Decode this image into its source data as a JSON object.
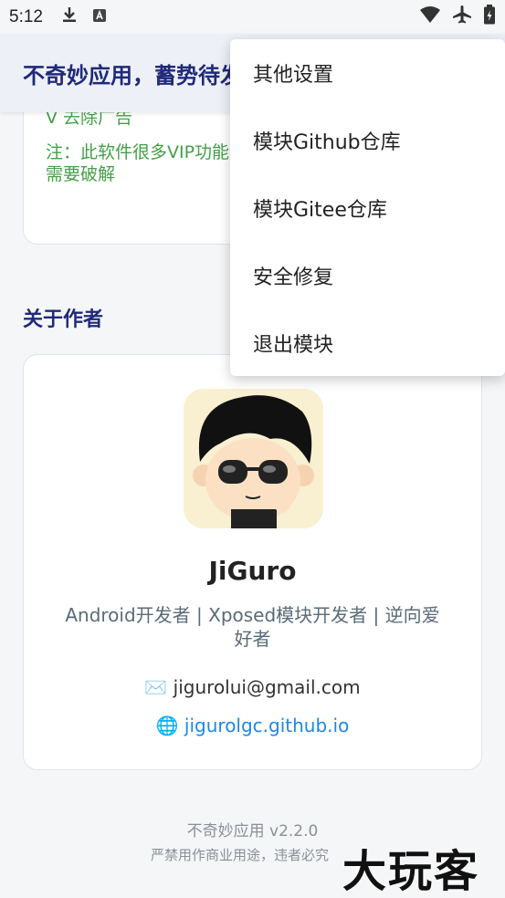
{
  "status_bar": {
    "time": "5:12"
  },
  "app_bar": {
    "title": "不奇妙应用，蓄势待发"
  },
  "notice": {
    "line1": "V 去除广告",
    "line2": "注：此软件很多VIP功能需要破解"
  },
  "about": {
    "section_title": "关于作者",
    "name": "JiGuro",
    "description": "Android开发者 | Xposed模块开发者 | 逆向爱好者",
    "email_icon": "✉️",
    "email": "jigurolui@gmail.com",
    "site_icon": "🌐",
    "site": "jigurolgc.github.io"
  },
  "footer": {
    "version": "不奇妙应用 v2.2.0",
    "warning": "严禁用作商业用途，违者必究"
  },
  "watermark": "大玩客",
  "menu": {
    "items": [
      {
        "label": "其他设置"
      },
      {
        "label": "模块Github仓库"
      },
      {
        "label": "模块Gitee仓库"
      },
      {
        "label": "安全修复"
      },
      {
        "label": "退出模块"
      }
    ]
  },
  "colors": {
    "primary": "#1f2a78",
    "accent_green": "#43a047",
    "link_blue": "#1e88e5"
  }
}
